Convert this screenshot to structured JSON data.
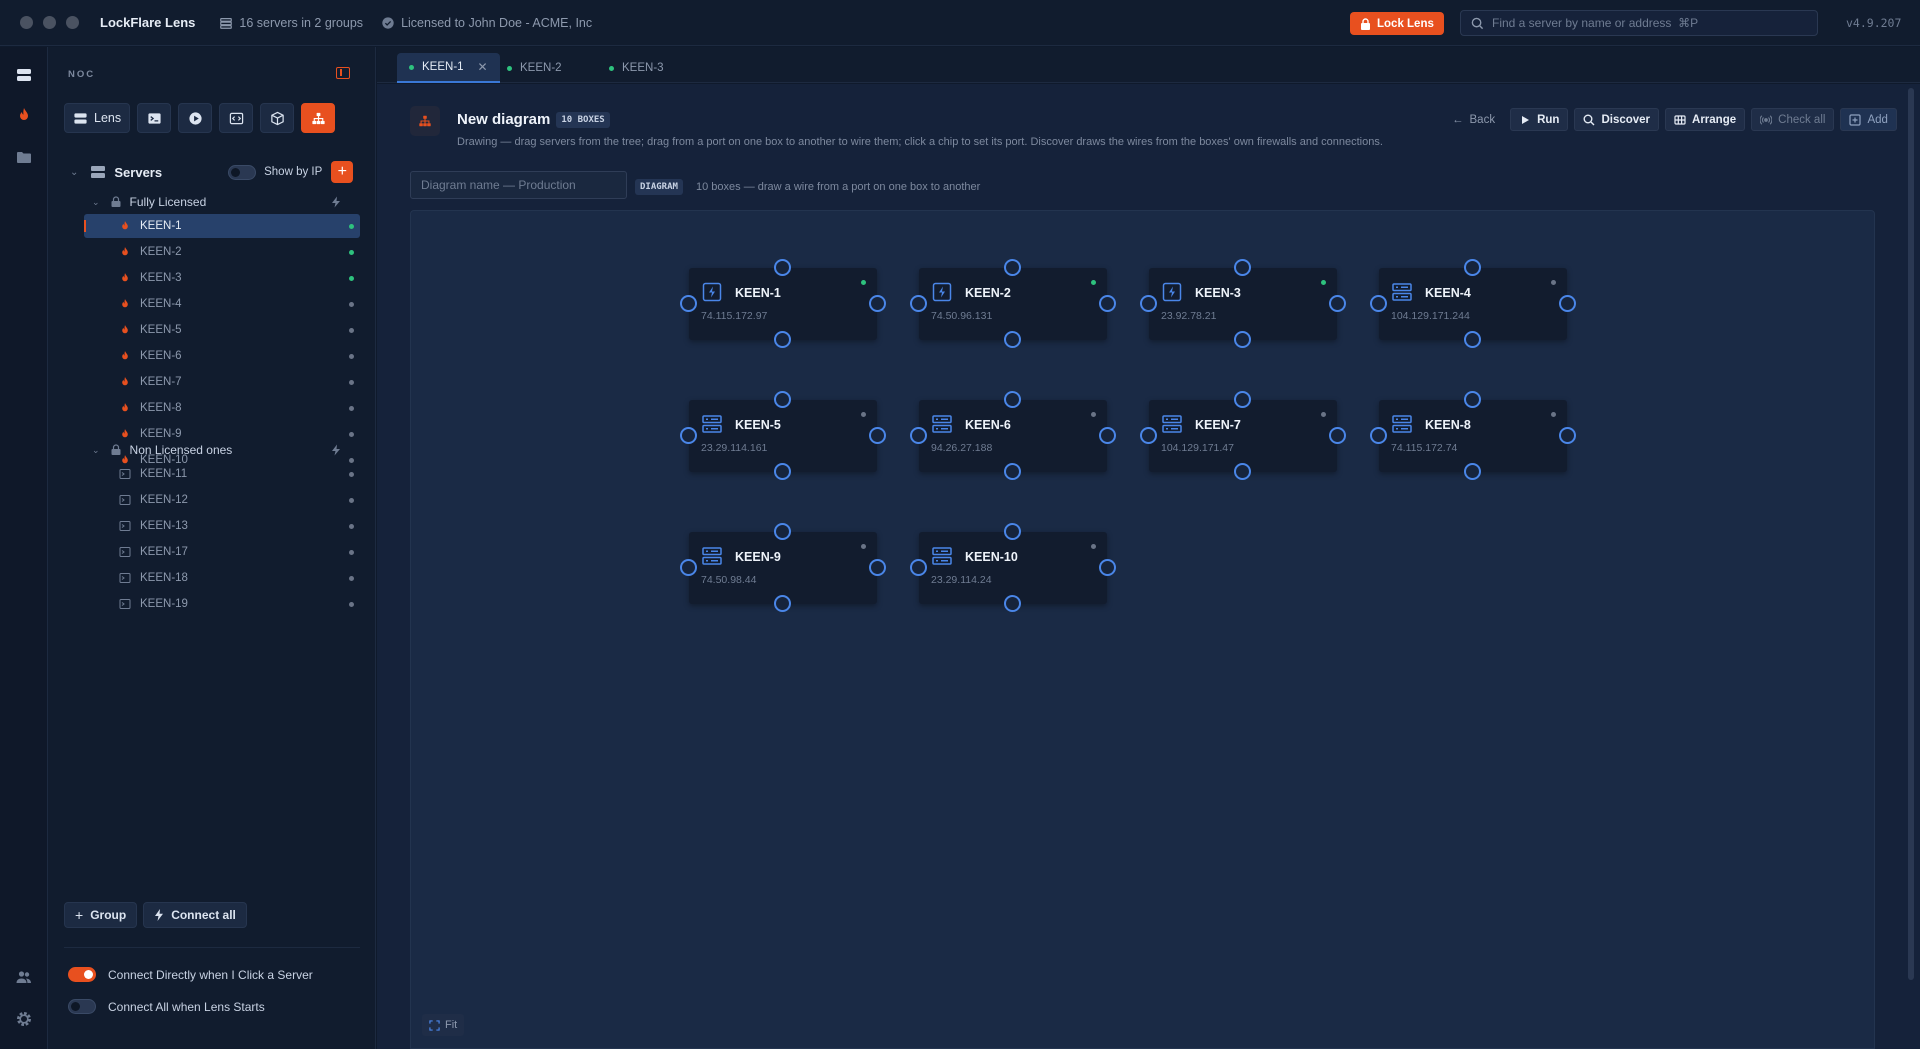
{
  "titlebar": {
    "app_title": "LockFlare Lens",
    "servers_summary": "16 servers in 2 groups",
    "license": "Licensed to John Doe - ACME, Inc",
    "lock_label": "Lock Lens",
    "search_placeholder": "Find a server by name or address  ⌘P",
    "version": "v4.9.207"
  },
  "sidebar": {
    "heading": "NOC",
    "toolbar": [
      {
        "label": "Lens",
        "icon": "server-stack-icon"
      },
      {
        "label": "",
        "icon": "terminal-icon"
      },
      {
        "label": "",
        "icon": "play-icon"
      },
      {
        "label": "",
        "icon": "code-icon"
      },
      {
        "label": "",
        "icon": "cube-icon"
      },
      {
        "label": "",
        "icon": "diagram-icon",
        "active": true
      }
    ],
    "servers_label": "Servers",
    "show_by_ip_label": "Show by IP",
    "show_by_ip_on": false,
    "groups": [
      {
        "name": "Fully Licensed",
        "servers": [
          {
            "name": "KEEN-1",
            "online": true,
            "selected": true
          },
          {
            "name": "KEEN-2",
            "online": true
          },
          {
            "name": "KEEN-3",
            "online": true
          },
          {
            "name": "KEEN-4",
            "online": false
          },
          {
            "name": "KEEN-5",
            "online": false
          },
          {
            "name": "KEEN-6",
            "online": false
          },
          {
            "name": "KEEN-7",
            "online": false
          },
          {
            "name": "KEEN-8",
            "online": false
          },
          {
            "name": "KEEN-9",
            "online": false
          },
          {
            "name": "KEEN-10",
            "online": false
          }
        ]
      },
      {
        "name": "Non Licensed ones",
        "servers": [
          {
            "name": "KEEN-11",
            "online": false
          },
          {
            "name": "KEEN-12",
            "online": false
          },
          {
            "name": "KEEN-13",
            "online": false
          },
          {
            "name": "KEEN-17",
            "online": false
          },
          {
            "name": "KEEN-18",
            "online": false
          },
          {
            "name": "KEEN-19",
            "online": false
          }
        ]
      }
    ],
    "group_button": "Group",
    "connect_all_button": "Connect all",
    "prefs": [
      {
        "label": "Connect Directly when I Click a Server",
        "on": true
      },
      {
        "label": "Connect All when Lens Starts",
        "on": false
      }
    ]
  },
  "tabs": [
    {
      "label": "KEEN-1",
      "active": true
    },
    {
      "label": "KEEN-2",
      "active": false
    },
    {
      "label": "KEEN-3",
      "active": false
    }
  ],
  "diagram": {
    "title": "New diagram",
    "box_badge": "10 BOXES",
    "subtitle": "Drawing — drag servers from the tree; drag from a port on one box to another to wire them; click a chip to set its port. Discover draws the wires from the boxes' own firewalls and connections.",
    "actions": {
      "back": "Back",
      "run": "Run",
      "discover": "Discover",
      "arrange": "Arrange",
      "check_all": "Check all",
      "add": "Add"
    },
    "name_placeholder": "Diagram name — Production",
    "tag": "DIAGRAM",
    "hint": "10 boxes — draw a wire from a port on one box to another",
    "fit_label": "Fit",
    "boxes": [
      {
        "name": "KEEN-1",
        "ip": "74.115.172.97",
        "kind": "bolt",
        "online": true
      },
      {
        "name": "KEEN-2",
        "ip": "74.50.96.131",
        "kind": "bolt",
        "online": true
      },
      {
        "name": "KEEN-3",
        "ip": "23.92.78.21",
        "kind": "bolt",
        "online": true
      },
      {
        "name": "KEEN-4",
        "ip": "104.129.171.244",
        "kind": "server",
        "online": false
      },
      {
        "name": "KEEN-5",
        "ip": "23.29.114.161",
        "kind": "server",
        "online": false
      },
      {
        "name": "KEEN-6",
        "ip": "94.26.27.188",
        "kind": "server",
        "online": false
      },
      {
        "name": "KEEN-7",
        "ip": "104.129.171.47",
        "kind": "server",
        "online": false
      },
      {
        "name": "KEEN-8",
        "ip": "74.115.172.74",
        "kind": "server",
        "online": false
      },
      {
        "name": "KEEN-9",
        "ip": "74.50.98.44",
        "kind": "server",
        "online": false
      },
      {
        "name": "KEEN-10",
        "ip": "23.29.114.24",
        "kind": "server",
        "online": false
      }
    ]
  },
  "colors": {
    "accent": "#e8501f",
    "port": "#4a86e8",
    "online": "#2ec27e",
    "offline": "#6a7487"
  }
}
